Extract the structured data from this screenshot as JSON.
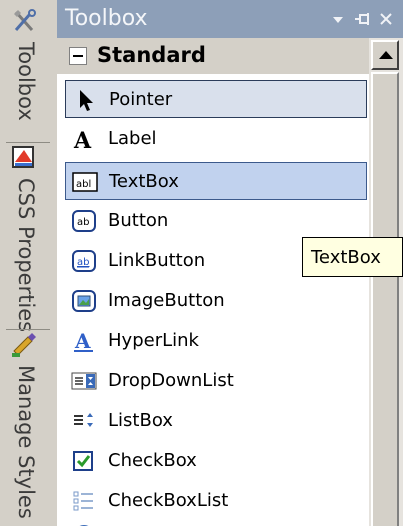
{
  "side_tabs": [
    {
      "label": "Toolbox",
      "icon": "toolbox-wrench-icon"
    },
    {
      "label": "CSS Properties",
      "icon": "css-properties-icon"
    },
    {
      "label": "Manage Styles",
      "icon": "manage-styles-icon"
    }
  ],
  "panel": {
    "title": "Toolbox",
    "buttons": {
      "dropdown": "▾",
      "pin": "⊣",
      "close": "×"
    }
  },
  "group": {
    "title": "Standard",
    "collapse_symbol": "−"
  },
  "items": [
    {
      "label": "Pointer",
      "icon": "pointer-icon",
      "state": "selected"
    },
    {
      "label": "Label",
      "icon": "label-icon",
      "state": "normal"
    },
    {
      "label": "TextBox",
      "icon": "textbox-icon",
      "state": "hover"
    },
    {
      "label": "Button",
      "icon": "button-icon",
      "state": "normal"
    },
    {
      "label": "LinkButton",
      "icon": "linkbutton-icon",
      "state": "normal"
    },
    {
      "label": "ImageButton",
      "icon": "imagebutton-icon",
      "state": "normal"
    },
    {
      "label": "HyperLink",
      "icon": "hyperlink-icon",
      "state": "normal"
    },
    {
      "label": "DropDownList",
      "icon": "dropdownlist-icon",
      "state": "normal"
    },
    {
      "label": "ListBox",
      "icon": "listbox-icon",
      "state": "normal"
    },
    {
      "label": "CheckBox",
      "icon": "checkbox-icon",
      "state": "normal"
    },
    {
      "label": "CheckBoxList",
      "icon": "checkboxlist-icon",
      "state": "normal"
    }
  ],
  "tooltip": {
    "text": "TextBox"
  },
  "colors": {
    "titlebar": "#8d9fb8",
    "hover_fill": "#c1d2ee",
    "selected_fill": "#d9e0ec",
    "tooltip_fill": "#ffffe1"
  }
}
